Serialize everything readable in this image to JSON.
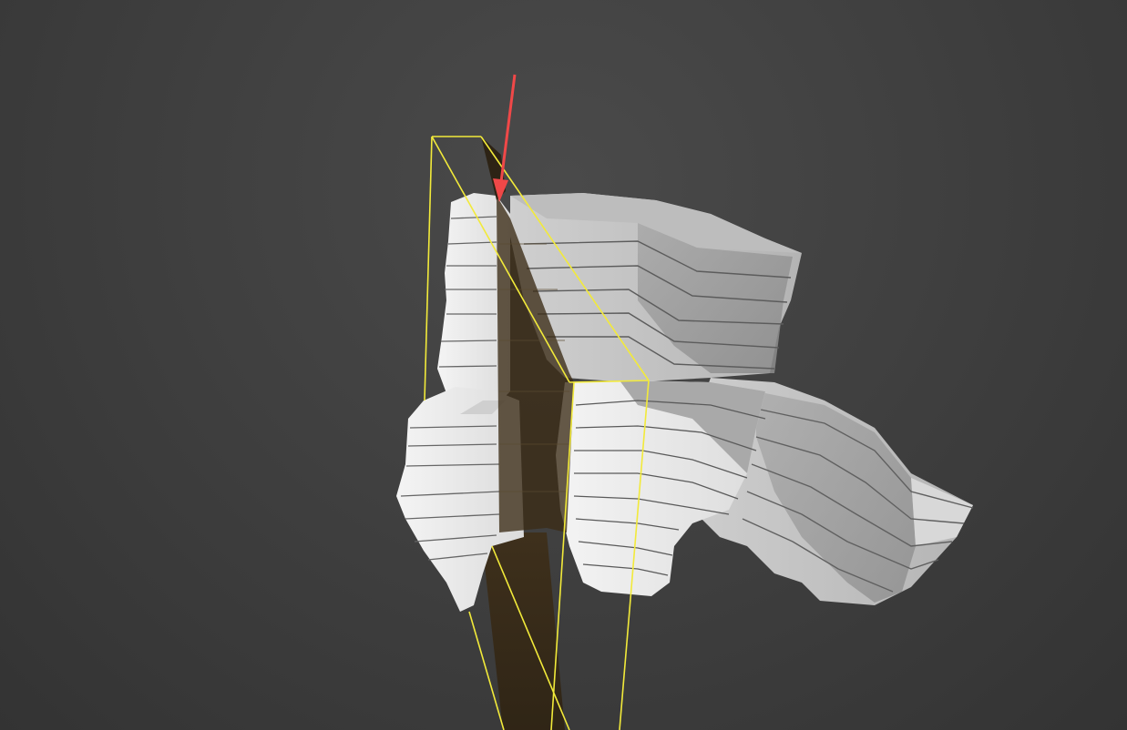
{
  "viewport": {
    "background_color": "#404040"
  },
  "model": {
    "description_icon": "sliced-3d-mesh",
    "surface_color": "#e6e6e6",
    "shadow_color": "#8c8c8c",
    "slice_line_color": "#555555"
  },
  "cutting_plane": {
    "fill_color": "#3b2e1a",
    "outline_color": "#f2ea3a"
  },
  "annotation": {
    "arrow_color": "#f04848",
    "icon": "arrow-down-icon"
  }
}
